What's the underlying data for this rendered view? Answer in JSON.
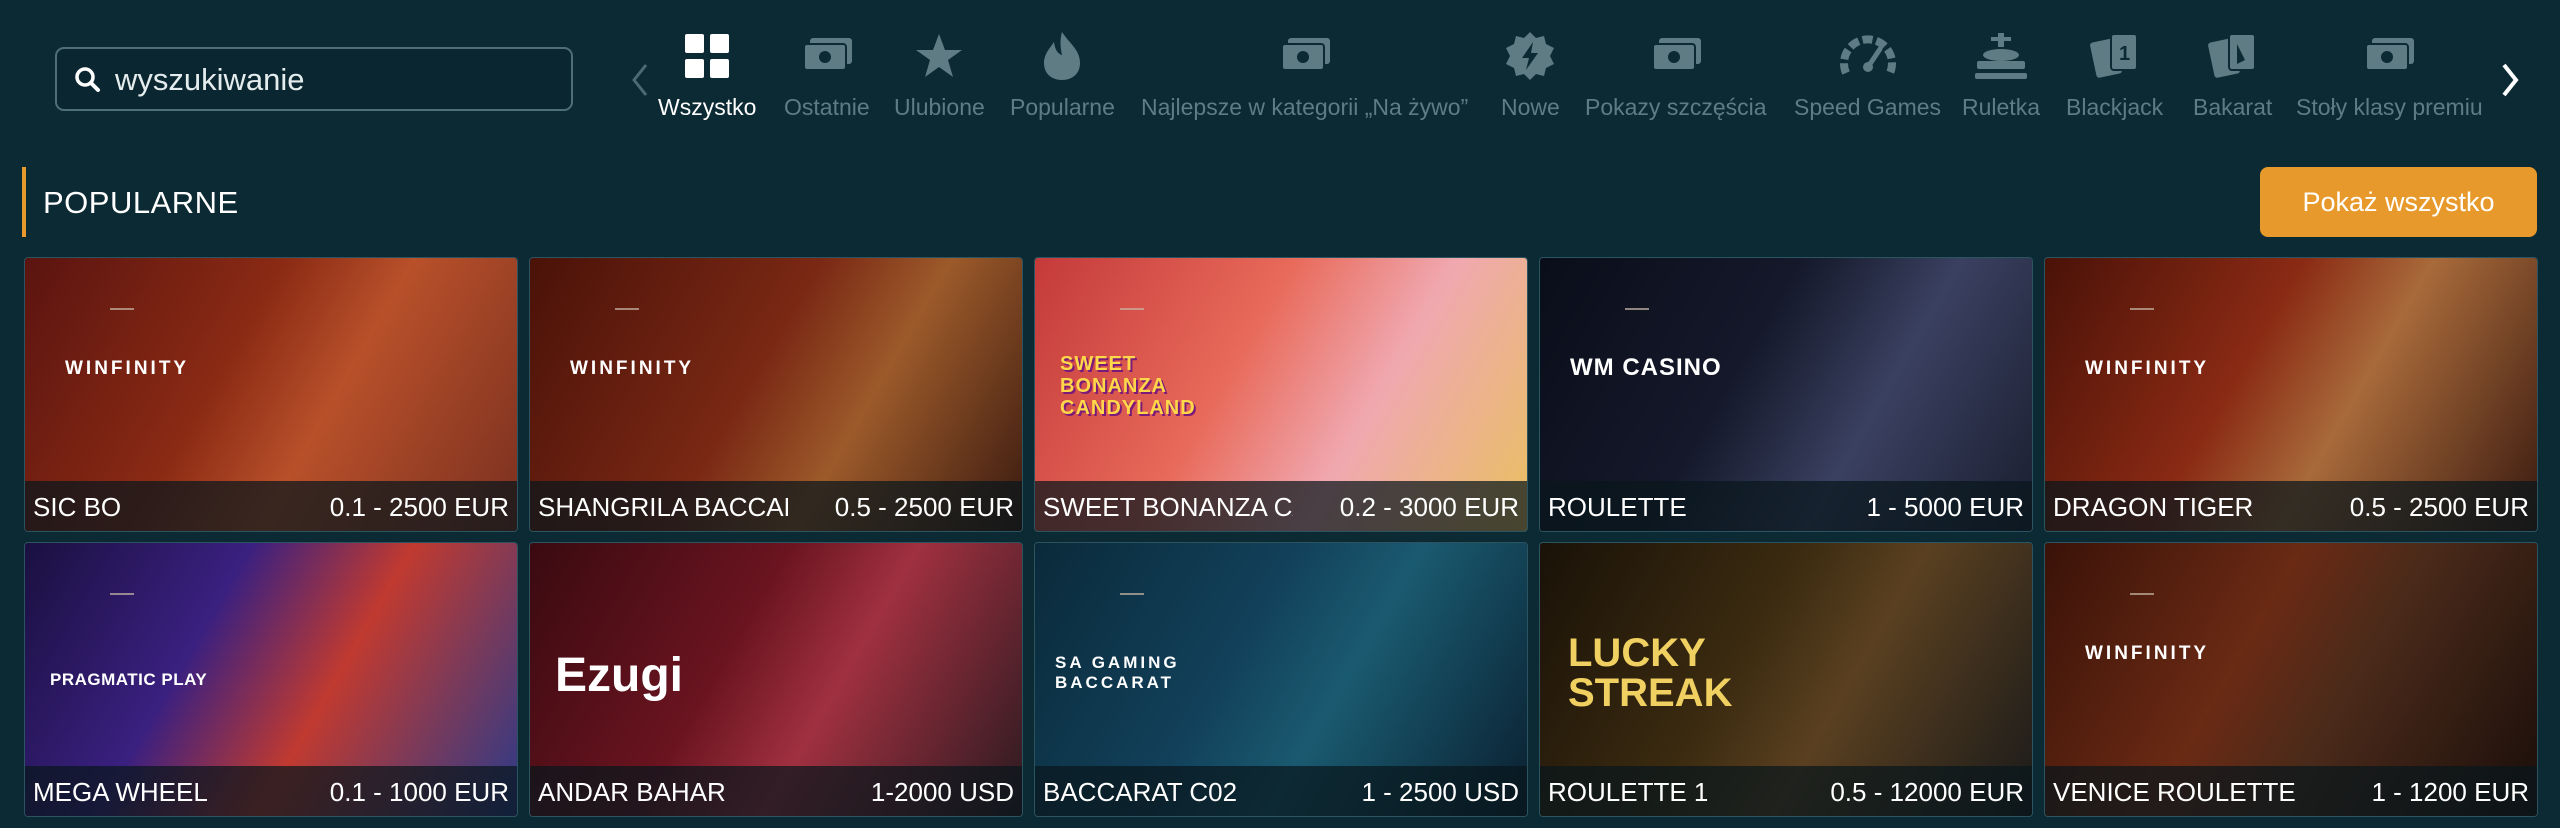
{
  "search": {
    "placeholder": "wyszukiwanie"
  },
  "categories": [
    {
      "label": "Wszystko",
      "icon": "grid-icon",
      "active": true
    },
    {
      "label": "Ostatnie",
      "icon": "money-icon",
      "active": false
    },
    {
      "label": "Ulubione",
      "icon": "star-icon",
      "active": false
    },
    {
      "label": "Popularne",
      "icon": "flame-icon",
      "active": false
    },
    {
      "label": "Najlepsze w kategorii „Na żywo”",
      "icon": "money-icon",
      "active": false
    },
    {
      "label": "Nowe",
      "icon": "badge-lightning-icon",
      "active": false
    },
    {
      "label": "Pokazy szczęścia",
      "icon": "money-icon",
      "active": false
    },
    {
      "label": "Speed Games",
      "icon": "speedometer-icon",
      "active": false
    },
    {
      "label": "Ruletka",
      "icon": "roulette-icon",
      "active": false
    },
    {
      "label": "Blackjack",
      "icon": "cards-icon",
      "active": false
    },
    {
      "label": "Bakarat",
      "icon": "cards-icon",
      "active": false
    },
    {
      "label": "Stoły klasy premiu",
      "icon": "money-icon",
      "active": false
    }
  ],
  "section": {
    "title": "POPULARNE",
    "show_all": "Pokaż wszystko"
  },
  "games": [
    {
      "name": "SIC BO",
      "limit": "0.1 - 2500 EUR",
      "provider": "WINFINITY"
    },
    {
      "name": "SHANGRILA BACCAR...",
      "limit": "0.5 - 2500 EUR",
      "provider": "WINFINITY"
    },
    {
      "name": "SWEET BONANZA CA...",
      "limit": "0.2 - 3000 EUR",
      "provider": "SWEET BONANZA CANDYLAND"
    },
    {
      "name": "ROULETTE",
      "limit": "1 - 5000 EUR",
      "provider": "WM CASINO"
    },
    {
      "name": "DRAGON TIGER",
      "limit": "0.5 - 2500 EUR",
      "provider": "WINFINITY"
    },
    {
      "name": "MEGA WHEEL",
      "limit": "0.1 - 1000 EUR",
      "provider": "PRAGMATIC PLAY"
    },
    {
      "name": "ANDAR BAHAR",
      "limit": "1-2000 USD",
      "provider": "Ezugi"
    },
    {
      "name": "BACCARAT C02",
      "limit": "1 - 2500 USD",
      "provider": "SA GAMING BACCARAT"
    },
    {
      "name": "ROULETTE 1",
      "limit": "0.5 - 12000 EUR",
      "provider": "LUCKY STREAK"
    },
    {
      "name": "VENICE ROULETTE",
      "limit": "1 - 1200 EUR",
      "provider": "WINFINITY"
    }
  ],
  "colors": {
    "background": "#0c2a33",
    "accent": "#e79a2b",
    "inactive": "#5f7c85"
  }
}
